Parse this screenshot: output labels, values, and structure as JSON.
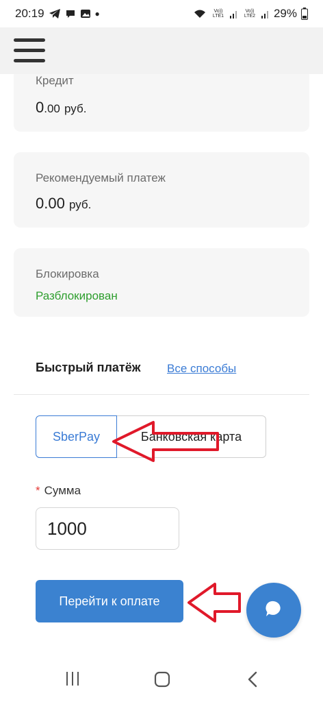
{
  "status_bar": {
    "time": "20:19",
    "battery": "29%",
    "sim1": "Vo)) LTE1",
    "sim2": "Vo)) LTE2"
  },
  "cards": {
    "credit": {
      "label": "Кредит",
      "value": "0",
      "decimals": ".00",
      "currency": "руб."
    },
    "payment": {
      "label": "Рекомендуемый платеж",
      "value": "0.00",
      "currency": "руб."
    },
    "block": {
      "label": "Блокировка",
      "status": "Разблокирован"
    }
  },
  "quick_pay": {
    "title": "Быстрый платёж",
    "all_methods": "Все способы",
    "options": [
      "SberPay",
      "Банковская карта"
    ],
    "selected": "SberPay"
  },
  "sum": {
    "required_mark": "*",
    "label": "Сумма",
    "value": "1000"
  },
  "pay_button": "Перейти к оплате",
  "colors": {
    "accent": "#3b82d0",
    "status_ok": "#2e9e2e",
    "annotation": "#e0192a"
  },
  "icons": [
    "telegram-icon",
    "chat-icon",
    "gallery-icon",
    "wifi-icon",
    "signal-icon",
    "battery-icon",
    "menu-icon",
    "chat-bubble-icon",
    "recent-apps-icon",
    "home-icon",
    "back-icon"
  ]
}
